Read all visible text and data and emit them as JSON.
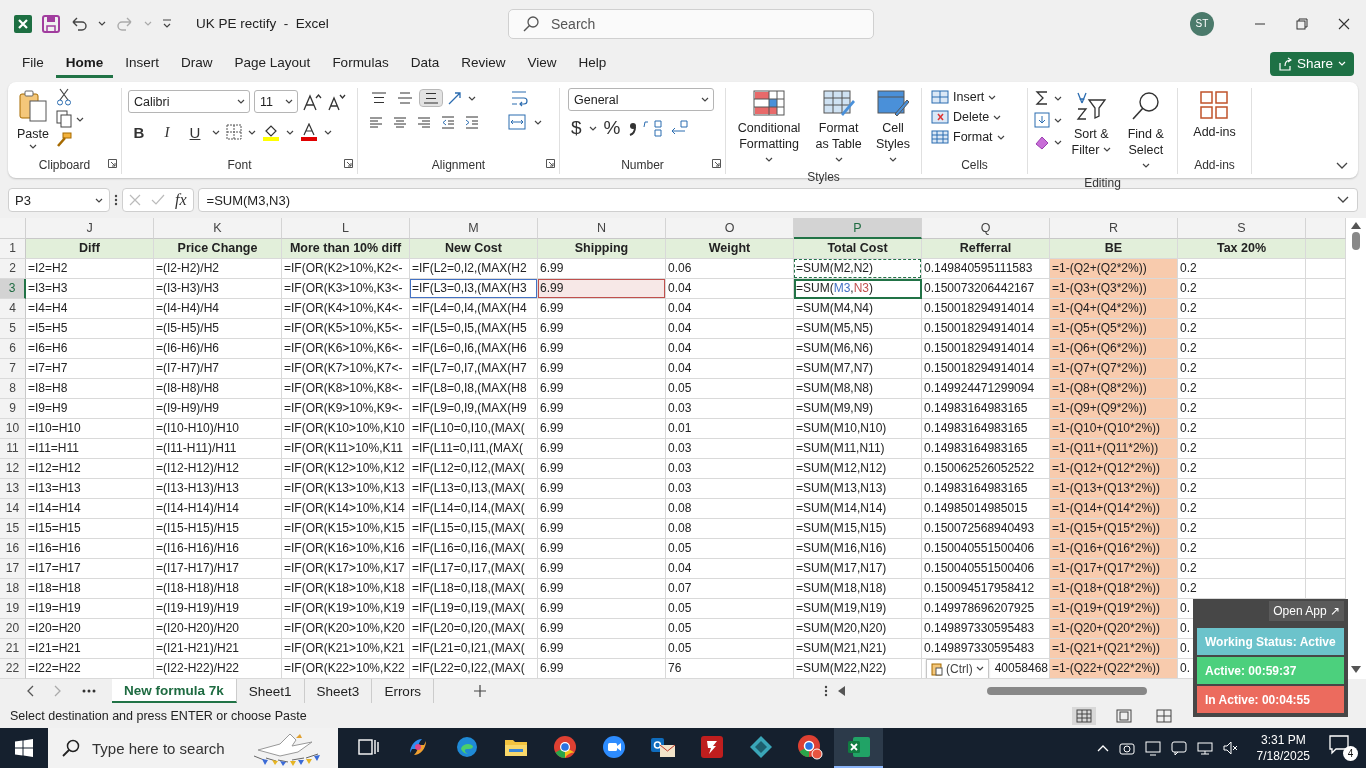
{
  "title_bar": {
    "title": "UK PE rectify  -  Excel",
    "search_placeholder": "Search",
    "avatar": "ST"
  },
  "menu_tabs": [
    {
      "label": "File",
      "selected": false
    },
    {
      "label": "Home",
      "selected": true
    },
    {
      "label": "Insert",
      "selected": false
    },
    {
      "label": "Draw",
      "selected": false
    },
    {
      "label": "Page Layout",
      "selected": false
    },
    {
      "label": "Formulas",
      "selected": false
    },
    {
      "label": "Data",
      "selected": false
    },
    {
      "label": "Review",
      "selected": false
    },
    {
      "label": "View",
      "selected": false
    },
    {
      "label": "Help",
      "selected": false
    }
  ],
  "share": "Share",
  "ribbon": {
    "clipboard": {
      "label": "Clipboard",
      "paste": "Paste"
    },
    "font": {
      "label": "Font",
      "family": "Calibri",
      "size": "11",
      "bold": "B",
      "italic": "I",
      "underline": "U"
    },
    "alignment": {
      "label": "Alignment",
      "vertical": [
        {
          "kind": "top",
          "selected": false
        },
        {
          "kind": "middle",
          "selected": false
        },
        {
          "kind": "bottom",
          "selected": true
        }
      ]
    },
    "number": {
      "label": "Number",
      "format": "General",
      "currency": "$",
      "percent": "%"
    },
    "styles": {
      "label": "Styles",
      "buttons": [
        "Conditional Formatting",
        "Format as Table",
        "Cell Styles"
      ]
    },
    "cells": {
      "label": "Cells",
      "buttons": [
        "Insert",
        "Delete",
        "Format"
      ]
    },
    "editing": {
      "label": "Editing",
      "buttons": [
        "Sort & Filter",
        "Find & Select"
      ]
    },
    "addins": {
      "label": "Add-ins",
      "button": "Add-ins"
    }
  },
  "formula_bar": {
    "name_box": "P3",
    "fx": "fx",
    "formula": "=SUM(M3,N3)"
  },
  "sheet": {
    "columns": [
      {
        "letter": "J",
        "selected": false,
        "highlighted": false
      },
      {
        "letter": "K",
        "selected": false,
        "highlighted": false
      },
      {
        "letter": "L",
        "selected": false,
        "highlighted": false
      },
      {
        "letter": "M",
        "selected": false,
        "highlighted": false
      },
      {
        "letter": "N",
        "selected": false,
        "highlighted": false
      },
      {
        "letter": "O",
        "selected": false,
        "highlighted": false
      },
      {
        "letter": "P",
        "selected": true,
        "highlighted": false
      },
      {
        "letter": "Q",
        "selected": false,
        "highlighted": false
      },
      {
        "letter": "R",
        "selected": false,
        "highlighted": true
      },
      {
        "letter": "S",
        "selected": false,
        "highlighted": false
      }
    ],
    "rows": [
      {
        "number": "1",
        "kind": "header",
        "selected": false,
        "copied": false,
        "cells": [
          "Diff",
          "Price Change",
          "More than 10% diff",
          "New Cost",
          "Shipping",
          "Weight",
          "Total Cost",
          "Refferral",
          "BE",
          "Tax 20%"
        ]
      },
      {
        "number": "2",
        "kind": "data",
        "selected": false,
        "copied": true,
        "cells": [
          "=I2=H2",
          "=(I2-H2)/H2",
          "=IF(OR(K2>10%,K2<-",
          "=IF(L2=0,I2,(MAX(H2",
          "6.99",
          "0.06",
          "=SUM(M2,N2)",
          "0.149840595111583",
          "=1-(Q2+(Q2*2%))",
          "0.2"
        ]
      },
      {
        "number": "3",
        "kind": "data",
        "selected": true,
        "copied": true,
        "cells": [
          "=I3=H3",
          "=(I3-H3)/H3",
          "=IF(OR(K3>10%,K3<-",
          {
            "text": "=IF(L3=0,I3,(MAX(H3",
            "color": "#4472c4"
          },
          {
            "text": "6.99",
            "color": "#c0504d"
          },
          "0.04",
          {
            "parts": [
              {
                "text": "=SUM("
              },
              {
                "text": "M3",
                "color": "#4472c4"
              },
              {
                "text": ","
              },
              {
                "text": "N3",
                "color": "#c0504d"
              },
              {
                "text": ")"
              }
            ]
          },
          "0.150073206442167",
          "=1-(Q3+(Q3*2%))",
          "0.2"
        ]
      },
      {
        "number": "4",
        "kind": "data",
        "selected": false,
        "copied": false,
        "cells": [
          "=I4=H4",
          "=(I4-H4)/H4",
          "=IF(OR(K4>10%,K4<-",
          "=IF(L4=0,I4,(MAX(H4",
          "6.99",
          "0.04",
          "=SUM(M4,N4)",
          "0.150018294914014",
          "=1-(Q4+(Q4*2%))",
          "0.2"
        ]
      },
      {
        "number": "5",
        "kind": "data",
        "selected": false,
        "copied": false,
        "cells": [
          "=I5=H5",
          "=(I5-H5)/H5",
          "=IF(OR(K5>10%,K5<-",
          "=IF(L5=0,I5,(MAX(H5",
          "6.99",
          "0.04",
          "=SUM(M5,N5)",
          "0.150018294914014",
          "=1-(Q5+(Q5*2%))",
          "0.2"
        ]
      },
      {
        "number": "6",
        "kind": "data",
        "selected": false,
        "copied": false,
        "cells": [
          "=I6=H6",
          "=(I6-H6)/H6",
          "=IF(OR(K6>10%,K6<-",
          "=IF(L6=0,I6,(MAX(H6",
          "6.99",
          "0.04",
          "=SUM(M6,N6)",
          "0.150018294914014",
          "=1-(Q6+(Q6*2%))",
          "0.2"
        ]
      },
      {
        "number": "7",
        "kind": "data",
        "selected": false,
        "copied": false,
        "cells": [
          "=I7=H7",
          "=(I7-H7)/H7",
          "=IF(OR(K7>10%,K7<-",
          "=IF(L7=0,I7,(MAX(H7",
          "6.99",
          "0.04",
          "=SUM(M7,N7)",
          "0.150018294914014",
          "=1-(Q7+(Q7*2%))",
          "0.2"
        ]
      },
      {
        "number": "8",
        "kind": "data",
        "selected": false,
        "copied": false,
        "cells": [
          "=I8=H8",
          "=(I8-H8)/H8",
          "=IF(OR(K8>10%,K8<-",
          "=IF(L8=0,I8,(MAX(H8",
          "6.99",
          "0.05",
          "=SUM(M8,N8)",
          "0.149924471299094",
          "=1-(Q8+(Q8*2%))",
          "0.2"
        ]
      },
      {
        "number": "9",
        "kind": "data",
        "selected": false,
        "copied": false,
        "cells": [
          "=I9=H9",
          "=(I9-H9)/H9",
          "=IF(OR(K9>10%,K9<-",
          "=IF(L9=0,I9,(MAX(H9",
          "6.99",
          "0.03",
          "=SUM(M9,N9)",
          "0.14983164983165",
          "=1-(Q9+(Q9*2%))",
          "0.2"
        ]
      },
      {
        "number": "10",
        "kind": "data",
        "selected": false,
        "copied": false,
        "cells": [
          "=I10=H10",
          "=(I10-H10)/H10",
          "=IF(OR(K10>10%,K10",
          "=IF(L10=0,I10,(MAX(",
          "6.99",
          "0.01",
          "=SUM(M10,N10)",
          "0.14983164983165",
          "=1-(Q10+(Q10*2%))",
          "0.2"
        ]
      },
      {
        "number": "11",
        "kind": "data",
        "selected": false,
        "copied": false,
        "cells": [
          "=I11=H11",
          "=(I11-H11)/H11",
          "=IF(OR(K11>10%,K11",
          "=IF(L11=0,I11,(MAX(",
          "6.99",
          "0.03",
          "=SUM(M11,N11)",
          "0.14983164983165",
          "=1-(Q11+(Q11*2%))",
          "0.2"
        ]
      },
      {
        "number": "12",
        "kind": "data",
        "selected": false,
        "copied": false,
        "cells": [
          "=I12=H12",
          "=(I12-H12)/H12",
          "=IF(OR(K12>10%,K12",
          "=IF(L12=0,I12,(MAX(",
          "6.99",
          "0.03",
          "=SUM(M12,N12)",
          "0.150062526052522",
          "=1-(Q12+(Q12*2%))",
          "0.2"
        ]
      },
      {
        "number": "13",
        "kind": "data",
        "selected": false,
        "copied": false,
        "cells": [
          "=I13=H13",
          "=(I13-H13)/H13",
          "=IF(OR(K13>10%,K13",
          "=IF(L13=0,I13,(MAX(",
          "6.99",
          "0.03",
          "=SUM(M13,N13)",
          "0.14983164983165",
          "=1-(Q13+(Q13*2%))",
          "0.2"
        ]
      },
      {
        "number": "14",
        "kind": "data",
        "selected": false,
        "copied": false,
        "cells": [
          "=I14=H14",
          "=(I14-H14)/H14",
          "=IF(OR(K14>10%,K14",
          "=IF(L14=0,I14,(MAX(",
          "6.99",
          "0.08",
          "=SUM(M14,N14)",
          "0.14985014985015",
          "=1-(Q14+(Q14*2%))",
          "0.2"
        ]
      },
      {
        "number": "15",
        "kind": "data",
        "selected": false,
        "copied": false,
        "cells": [
          "=I15=H15",
          "=(I15-H15)/H15",
          "=IF(OR(K15>10%,K15",
          "=IF(L15=0,I15,(MAX(",
          "6.99",
          "0.08",
          "=SUM(M15,N15)",
          "0.150072568940493",
          "=1-(Q15+(Q15*2%))",
          "0.2"
        ]
      },
      {
        "number": "16",
        "kind": "data",
        "selected": false,
        "copied": false,
        "cells": [
          "=I16=H16",
          "=(I16-H16)/H16",
          "=IF(OR(K16>10%,K16",
          "=IF(L16=0,I16,(MAX(",
          "6.99",
          "0.05",
          "=SUM(M16,N16)",
          "0.150040551500406",
          "=1-(Q16+(Q16*2%))",
          "0.2"
        ]
      },
      {
        "number": "17",
        "kind": "data",
        "selected": false,
        "copied": false,
        "cells": [
          "=I17=H17",
          "=(I17-H17)/H17",
          "=IF(OR(K17>10%,K17",
          "=IF(L17=0,I17,(MAX(",
          "6.99",
          "0.04",
          "=SUM(M17,N17)",
          "0.150040551500406",
          "=1-(Q17+(Q17*2%))",
          "0.2"
        ]
      },
      {
        "number": "18",
        "kind": "data",
        "selected": false,
        "copied": false,
        "cells": [
          "=I18=H18",
          "=(I18-H18)/H18",
          "=IF(OR(K18>10%,K18",
          "=IF(L18=0,I18,(MAX(",
          "6.99",
          "0.07",
          "=SUM(M18,N18)",
          "0.150094517958412",
          "=1-(Q18+(Q18*2%))",
          "0.2"
        ]
      },
      {
        "number": "19",
        "kind": "data",
        "selected": false,
        "copied": false,
        "cells": [
          "=I19=H19",
          "=(I19-H19)/H19",
          "=IF(OR(K19>10%,K19",
          "=IF(L19=0,I19,(MAX(",
          "6.99",
          "0.05",
          "=SUM(M19,N19)",
          "0.149978696207925",
          "=1-(Q19+(Q19*2%))",
          "0."
        ]
      },
      {
        "number": "20",
        "kind": "data",
        "selected": false,
        "copied": false,
        "cells": [
          "=I20=H20",
          "=(I20-H20)/H20",
          "=IF(OR(K20>10%,K20",
          "=IF(L20=0,I20,(MAX(",
          "6.99",
          "0.05",
          "=SUM(M20,N20)",
          "0.149897330595483",
          "=1-(Q20+(Q20*2%))",
          "0."
        ]
      },
      {
        "number": "21",
        "kind": "data",
        "selected": false,
        "copied": false,
        "cells": [
          "=I21=H21",
          "=(I21-H21)/H21",
          "=IF(OR(K21>10%,K21",
          "=IF(L21=0,I21,(MAX(",
          "6.99",
          "0.05",
          "=SUM(M21,N21)",
          "0.149897330595483",
          "=1-(Q21+(Q21*2%))",
          "0."
        ]
      },
      {
        "number": "22",
        "kind": "data",
        "selected": false,
        "copied": false,
        "cells": [
          "=I22=H22",
          "=(I22-H22)/H22",
          "=IF(OR(K22>10%,K22",
          "=IF(L22=0,I22,(MAX(",
          "6.99",
          "76",
          "=SUM(M22,N22)",
          {
            "text": "40058468",
            "paste_options": "(Ctrl)"
          },
          "=1-(Q22+(Q22*2%))",
          "0."
        ]
      }
    ]
  },
  "sheet_tabs": [
    {
      "label": "New formula 7k",
      "selected": true
    },
    {
      "label": "Sheet1",
      "selected": false
    },
    {
      "label": "Sheet3",
      "selected": false
    },
    {
      "label": "Errors",
      "selected": false
    }
  ],
  "status_bar": {
    "message": "Select destination and press ENTER or choose Paste"
  },
  "tracker": {
    "open_app": "Open App ↗",
    "status": "Working Status: Active",
    "active": "Active: 00:59:37",
    "inactive": "In Active: 00:04:55"
  },
  "taskbar": {
    "search_placeholder": "Type here to search",
    "apps": [
      {
        "kind": "task-view",
        "active": false
      },
      {
        "kind": "copilot",
        "active": false
      },
      {
        "kind": "edge",
        "active": false
      },
      {
        "kind": "folder",
        "active": false
      },
      {
        "kind": "chrome",
        "active": false
      },
      {
        "kind": "zoom",
        "active": false
      },
      {
        "kind": "mail",
        "active": false
      },
      {
        "kind": "filezilla",
        "active": false
      },
      {
        "kind": "diamond",
        "active": false
      },
      {
        "kind": "chrome-profile",
        "active": false
      },
      {
        "kind": "excel",
        "active": true
      }
    ],
    "time": "3:31 PM",
    "date": "7/18/2025",
    "notifications": "4"
  }
}
